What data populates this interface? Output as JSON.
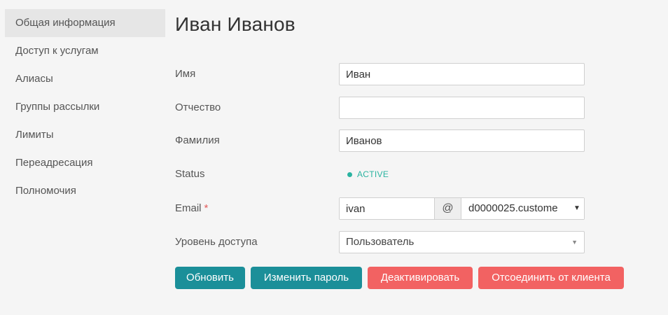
{
  "sidebar": {
    "items": [
      {
        "label": "Общая информация",
        "active": true
      },
      {
        "label": "Доступ к услугам"
      },
      {
        "label": "Алиасы"
      },
      {
        "label": "Группы рассылки"
      },
      {
        "label": "Лимиты"
      },
      {
        "label": "Переадресация"
      },
      {
        "label": "Полномочия"
      }
    ]
  },
  "main": {
    "title": "Иван Иванов",
    "form": {
      "first_name": {
        "label": "Имя",
        "value": "Иван"
      },
      "middle_name": {
        "label": "Отчество",
        "value": ""
      },
      "last_name": {
        "label": "Фамилия",
        "value": "Иванов"
      },
      "status": {
        "label": "Status",
        "value": "ACTIVE",
        "color": "#2ab3a0"
      },
      "email": {
        "label": "Email",
        "required_mark": "*",
        "local": "ivan",
        "at": "@",
        "domain": "d0000025.custome",
        "arrow": "▼"
      },
      "access_level": {
        "label": "Уровень доступа",
        "value": "Пользователь",
        "arrow": "▼"
      }
    },
    "buttons": {
      "update": "Обновить",
      "change_password": "Изменить пароль",
      "deactivate": "Деактивировать",
      "detach": "Отсоединить от клиента"
    }
  },
  "colors": {
    "teal": "#1b8f99",
    "red": "#f26262",
    "status": "#2ab3a0",
    "required": "#e25c5c"
  }
}
